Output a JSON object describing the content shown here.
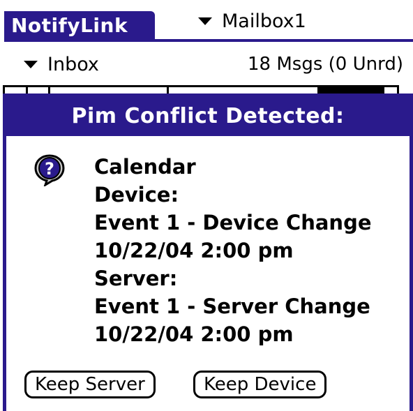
{
  "app": {
    "name": "NotifyLink",
    "accent_color": "#2a1a8c"
  },
  "header": {
    "mailbox_label": "Mailbox1",
    "folder_label": "Inbox",
    "message_count": "18 Msgs (0 Unrd)"
  },
  "dialog": {
    "title": "Pim Conflict Detected:",
    "icon": "question-icon",
    "lines": [
      "Calendar",
      "Device:",
      "Event 1 - Device Change",
      "10/22/04 2:00 pm",
      "Server:",
      "Event 1 - Server Change",
      "10/22/04 2:00 pm"
    ],
    "buttons": {
      "keep_server": "Keep Server",
      "keep_device": "Keep Device"
    }
  }
}
